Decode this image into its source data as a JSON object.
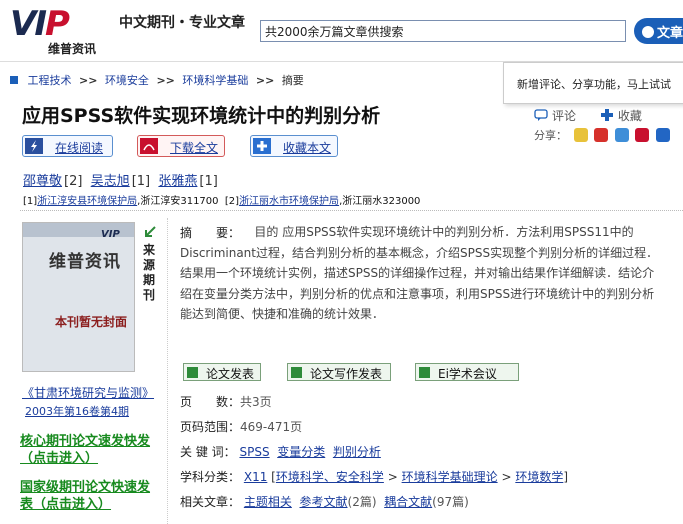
{
  "header": {
    "logo_text": "VIP",
    "logo_sub": "维普资讯",
    "tagline": "中文期刊・专业文章",
    "search_value": "共2000余万篇文章供搜索",
    "search_button": "文章"
  },
  "breadcrumb": [
    "工程技术",
    "环境安全",
    "环境科学基础",
    "摘要"
  ],
  "breadcrumb_sep": ">>",
  "notice": "新增评论、分享功能，马上试试",
  "title": "应用SPSS软件实现环境统计中的判别分析",
  "tools": {
    "comment": "评论",
    "favorite": "收藏",
    "share_label": "分享："
  },
  "actions": {
    "read_online": "在线阅读",
    "download": "下载全文",
    "collect": "收藏本文"
  },
  "authors": [
    {
      "name": "邵尊敬",
      "ref": "[2]"
    },
    {
      "name": "吴志旭",
      "ref": "[1]"
    },
    {
      "name": "张雅燕",
      "ref": "[1]"
    }
  ],
  "affiliations": [
    {
      "ref": "[1]",
      "org": "浙江淳安县环境保护局",
      "place": ",浙江淳安311700"
    },
    {
      "ref": "[2]",
      "org": "浙江丽水市环境保护局",
      "place": ",浙江丽水323000"
    }
  ],
  "cover": {
    "brand": "维普资讯",
    "no_cover": "本刊暂无封面",
    "mini_logo": "VIP"
  },
  "source_label": "来源期刊",
  "journal": "《甘肃环境研究与监测》",
  "issue": "2003年第16卷第4期",
  "promos": [
    "核心期刊论文速发快发（点击进入）",
    "国家级期刊论文快速发表（点击进入）"
  ],
  "abstract": {
    "label": "摘　　要：",
    "text": "目的 应用SPSS软件实现环境统计中的判别分析．方法利用SPSS11中的Discriminant过程，结合判别分析的基本概念，介绍SPSS实现整个判别分析的详细过程．结果用一个环境统计实例，描述SPSS的详细操作过程，并对输出结果作详细解读．结论介绍在变量分类方法中，判别分析的优点和注意事项，利用SPSS进行环境统计中的判别分析能达到简便、快捷和准确的统计效果．"
  },
  "tag_buttons": [
    "论文发表",
    "论文写作发表",
    "Ei学术会议"
  ],
  "meta": {
    "pages_key": "页　　数：",
    "pages_val": "共3页",
    "range_key": "页码范围：",
    "range_val": "469-471页",
    "keywords_key": "关 键 词：",
    "keywords": [
      "SPSS",
      "变量分类",
      "判别分析"
    ],
    "subject_key": "学科分类：",
    "subject_code": "X11",
    "subject_path": [
      "环境科学、安全科学",
      "环境科学基础理论",
      "环境数学"
    ],
    "related_key": "相关文章：",
    "related_theme": "主题相关",
    "related_refs": "参考文献",
    "related_refs_count": "(2篇)",
    "related_coupled": "耦合文献",
    "related_coupled_count": "(97篇)"
  }
}
